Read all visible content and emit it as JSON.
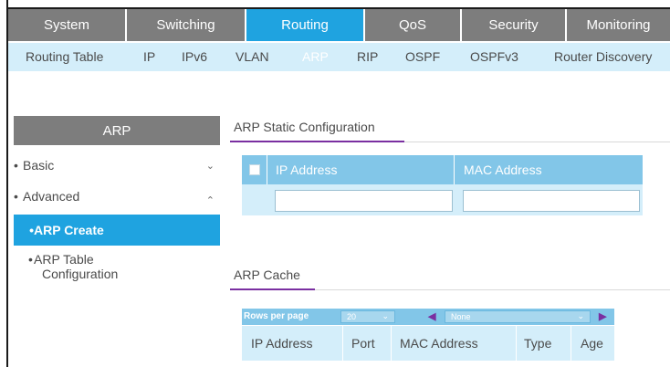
{
  "top_nav": {
    "tabs": [
      {
        "label": "System"
      },
      {
        "label": "Switching"
      },
      {
        "label": "Routing"
      },
      {
        "label": "QoS"
      },
      {
        "label": "Security"
      },
      {
        "label": "Monitoring"
      }
    ],
    "active": "Routing"
  },
  "sub_nav": {
    "tabs": [
      {
        "label": "Routing Table"
      },
      {
        "label": "IP"
      },
      {
        "label": "IPv6"
      },
      {
        "label": "VLAN"
      },
      {
        "label": "ARP"
      },
      {
        "label": "RIP"
      },
      {
        "label": "OSPF"
      },
      {
        "label": "OSPFv3"
      },
      {
        "label": "Router Discovery"
      }
    ],
    "active": "ARP"
  },
  "sidebar": {
    "title": "ARP",
    "items": [
      {
        "label": "Basic",
        "chevron": "⌄"
      },
      {
        "label": "Advanced",
        "chevron": "⌃"
      },
      {
        "label": "ARP Create"
      },
      {
        "label": "ARP Table",
        "label2": "Configuration"
      }
    ],
    "bullet": "•"
  },
  "static_config": {
    "title": "ARP Static Configuration",
    "columns": [
      "IP Address",
      "MAC Address"
    ],
    "ip_value": "",
    "mac_value": ""
  },
  "arp_cache": {
    "title": "ARP Cache",
    "pager": {
      "rows_label": "Rows per page",
      "rows_value": "20",
      "filter_value": "None"
    },
    "columns": [
      "IP Address",
      "Port",
      "MAC Address",
      "Type",
      "Age"
    ]
  },
  "colors": {
    "active_tab": "#1fa3e0",
    "nav_gray": "#7d7d7d",
    "subnav_bg": "#d4eefa",
    "section_line": "#7a2fa1"
  }
}
